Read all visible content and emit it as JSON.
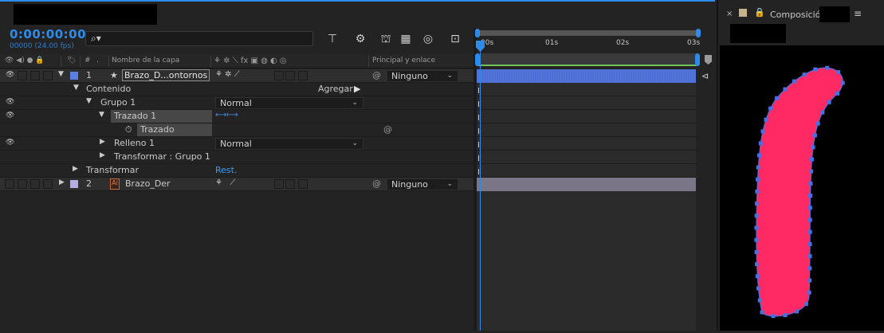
{
  "timeline": {
    "timecode": "0:00:00:00",
    "fps": "00000 (24.00 fps)",
    "search_placeholder": ""
  },
  "columns": {
    "number": "#",
    "layer_name": "Nombre de la capa",
    "parent_link": "Principal y enlace"
  },
  "time_ticks": [
    "00s",
    "01s",
    "02s",
    "03s"
  ],
  "layers": [
    {
      "index": "1",
      "name": "Brazo_D...ontornos",
      "parent": "Ninguno",
      "label_color": "#5b7fe0"
    },
    {
      "index": "2",
      "name": "Brazo_Der",
      "parent": "Ninguno",
      "label_color": "#b4aee0"
    }
  ],
  "properties": {
    "contents": "Contenido",
    "add_label": "Agregar:",
    "group": "Grupo 1",
    "group_mode": "Normal",
    "path_group": "Trazado 1",
    "path": "Trazado",
    "fill": "Relleno 1",
    "fill_mode": "Normal",
    "transform_group": "Transformar : Grupo 1",
    "transform": "Transformar",
    "reset": "Rest."
  },
  "composition": {
    "tab_label": "Composición",
    "shape_color": "#ff2a64",
    "point_color": "#4a6fe0"
  },
  "colors": {
    "accent": "#2d8ceb",
    "track_bar": "#5b7fe0"
  }
}
